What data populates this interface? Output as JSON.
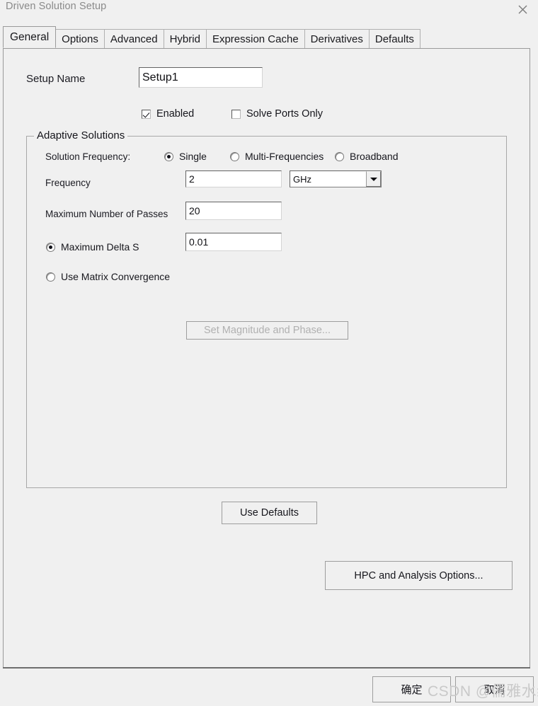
{
  "window": {
    "title": "Driven Solution Setup",
    "close_icon": "close-icon"
  },
  "tabs": [
    {
      "label": "General",
      "active": true
    },
    {
      "label": "Options",
      "active": false
    },
    {
      "label": "Advanced",
      "active": false
    },
    {
      "label": "Hybrid",
      "active": false
    },
    {
      "label": "Expression Cache",
      "active": false
    },
    {
      "label": "Derivatives",
      "active": false
    },
    {
      "label": "Defaults",
      "active": false
    }
  ],
  "general": {
    "setup_name_label": "Setup Name",
    "setup_name_value": "Setup1",
    "enabled_label": "Enabled",
    "enabled_checked": true,
    "solve_ports_only_label": "Solve Ports Only",
    "solve_ports_only_checked": false
  },
  "adaptive_solutions": {
    "title": "Adaptive Solutions",
    "solution_frequency_label": "Solution Frequency:",
    "frequency_modes": [
      {
        "label": "Single",
        "selected": true
      },
      {
        "label": "Multi-Frequencies",
        "selected": false
      },
      {
        "label": "Broadband",
        "selected": false
      }
    ],
    "frequency_label": "Frequency",
    "frequency_value": "2",
    "frequency_unit": "GHz",
    "max_passes_label": "Maximum Number of Passes",
    "max_passes_value": "20",
    "max_delta_s_label": "Maximum Delta S",
    "max_delta_s_selected": true,
    "max_delta_s_value": "0.01",
    "use_matrix_convergence_label": "Use Matrix Convergence",
    "use_matrix_convergence_selected": false,
    "set_magnitude_phase_label": "Set Magnitude and Phase...",
    "set_magnitude_phase_enabled": false
  },
  "buttons": {
    "use_defaults": "Use Defaults",
    "hpc_analysis_options": "HPC and Analysis Options...",
    "ok": "确定",
    "cancel": "取消"
  },
  "watermark": {
    "text": "CSDN @儒雅水缘"
  }
}
